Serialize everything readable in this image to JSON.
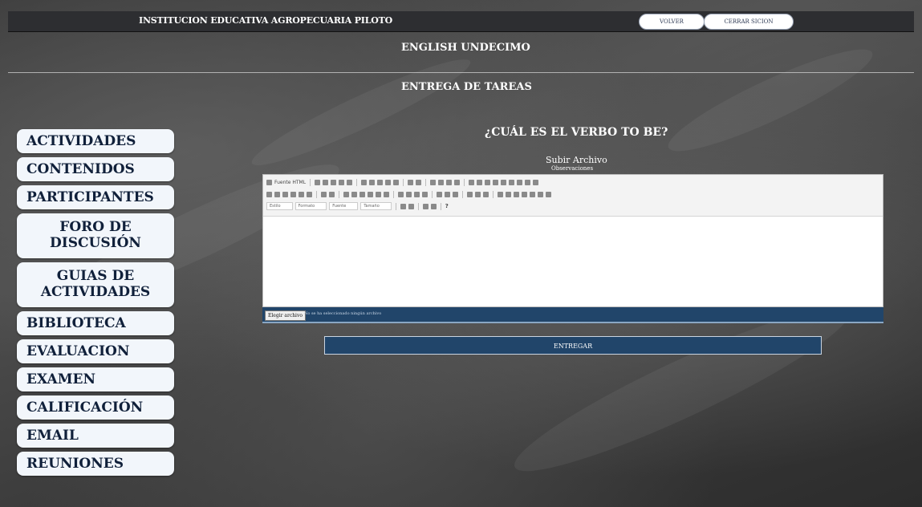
{
  "header": {
    "school_name": "INSTITUCION EDUCATIVA AGROPECUARIA PILOTO",
    "back_label": "VOLVER",
    "logout_label": "CERRAR SICION"
  },
  "course_title": "ENGLISH UNDECIMO",
  "section_title": "ENTREGA DE TAREAS",
  "sidebar": {
    "items": [
      {
        "label": "ACTIVIDADES"
      },
      {
        "label": "CONTENIDOS"
      },
      {
        "label": "PARTICIPANTES"
      },
      {
        "label": "FORO DE DISCUSIÓN"
      },
      {
        "label": "GUIAS DE ACTIVIDADES"
      },
      {
        "label": "BIBLIOTECA"
      },
      {
        "label": "EVALUACION"
      },
      {
        "label": "EXAMEN"
      },
      {
        "label": "CALIFICACIÓN"
      },
      {
        "label": "EMAIL"
      },
      {
        "label": "REUNIONES"
      }
    ]
  },
  "task": {
    "question": "¿CUÁL ES EL VERBO TO BE?",
    "upload_label": "Subir Archivo",
    "observations_label": "Observaciones"
  },
  "editor": {
    "source_label": "Fuente HTML",
    "style_combo": "Estilo",
    "format_combo": "Formato",
    "font_combo": "Fuente",
    "size_combo": "Tamaño",
    "help_glyph": "?"
  },
  "file_input": {
    "button_label": "Elegir archivo",
    "status_text": "No se ha seleccionado ningún archivo"
  },
  "submit_label": "ENTREGAR",
  "colors": {
    "sidebar_bg": "#f2f6fb",
    "navy": "#21456a",
    "topbar": "#2d2e31"
  }
}
